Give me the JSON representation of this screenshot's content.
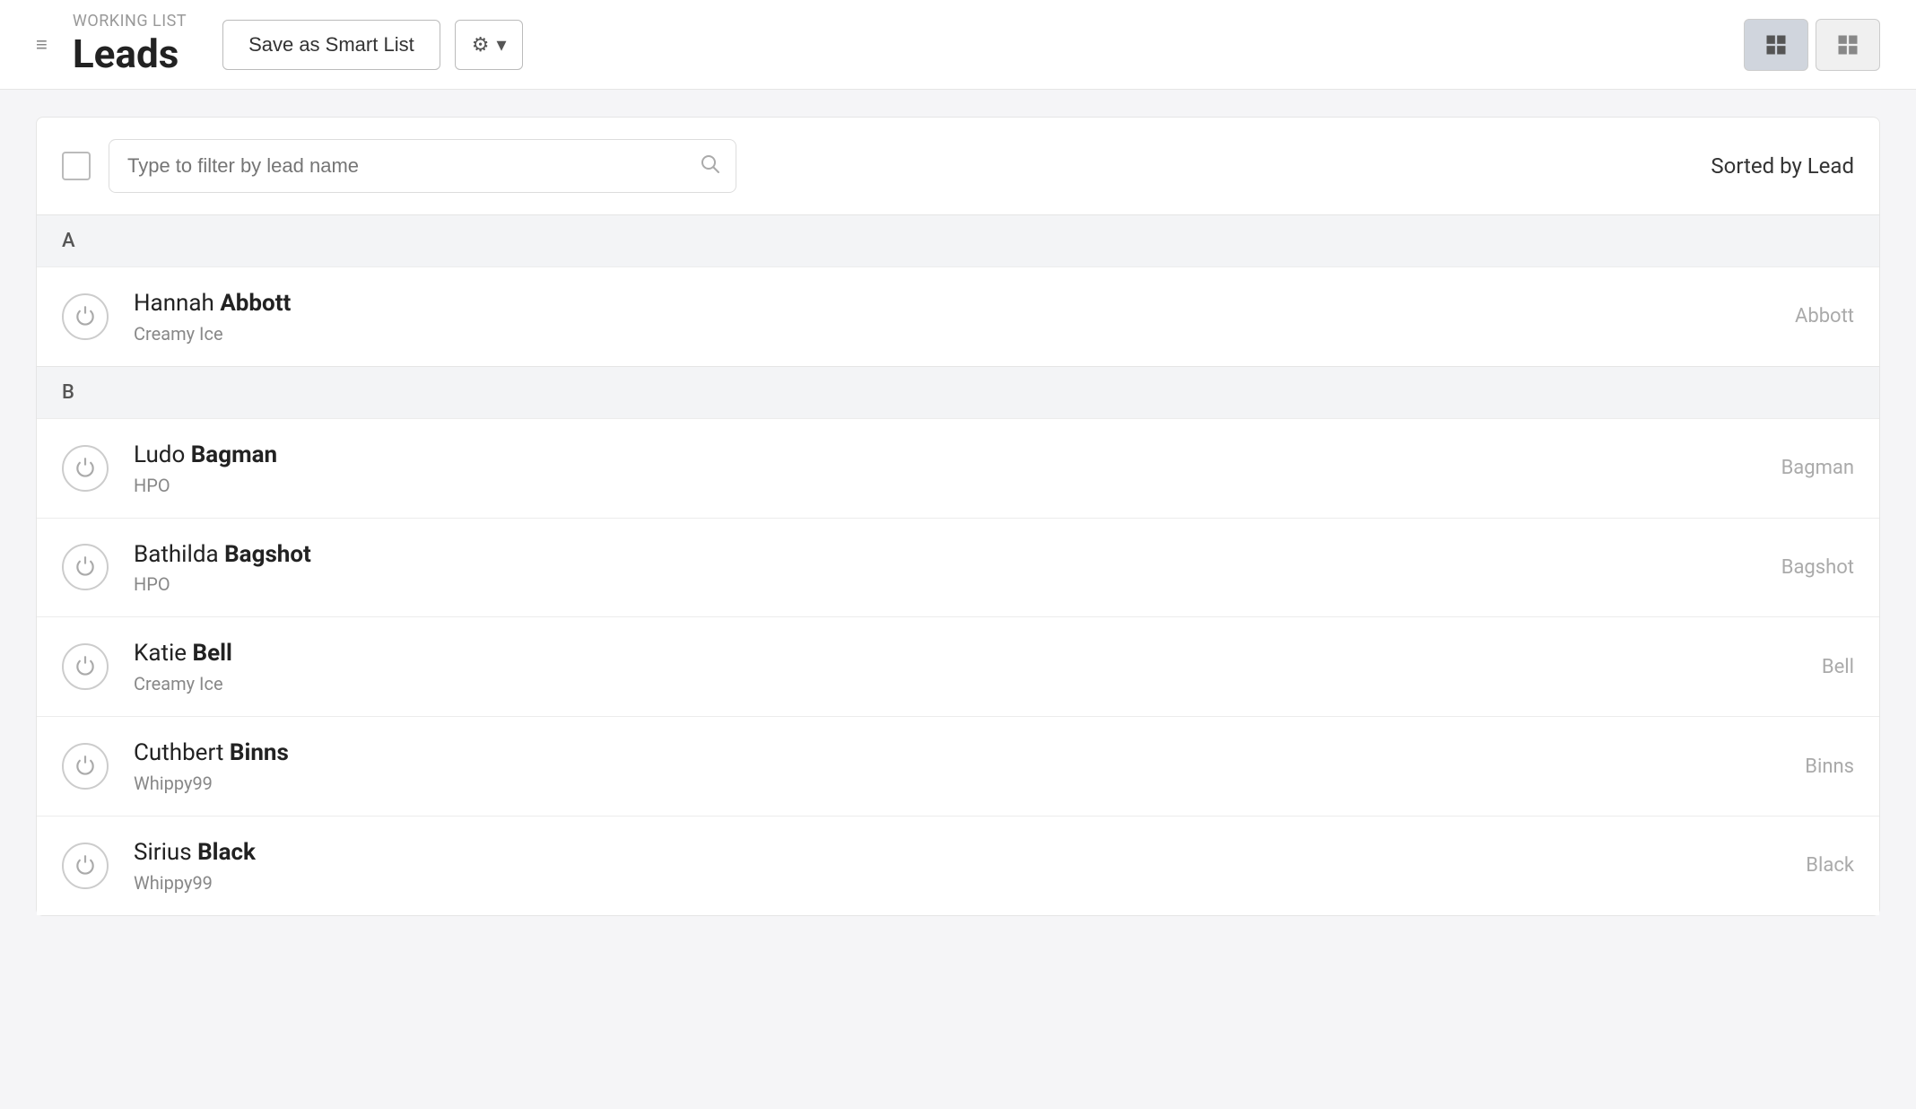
{
  "header": {
    "hamburger": "≡",
    "working_list_label": "WORKING LIST",
    "page_title": "Leads",
    "save_smart_list_label": "Save as Smart List",
    "gear_label": "⚙",
    "chevron_label": "▾",
    "view_list_icon": "▦",
    "view_grid_icon": "⊞"
  },
  "filter_bar": {
    "search_placeholder": "Type to filter by lead name",
    "search_icon": "🔍",
    "sorted_by_label": "Sorted by Lead"
  },
  "groups": [
    {
      "letter": "A",
      "items": [
        {
          "first_name": "Hannah",
          "last_name": "Abbott",
          "company": "Creamy Ice",
          "sort_label": "Abbott"
        }
      ]
    },
    {
      "letter": "B",
      "items": [
        {
          "first_name": "Ludo",
          "last_name": "Bagman",
          "company": "HPO",
          "sort_label": "Bagman"
        },
        {
          "first_name": "Bathilda",
          "last_name": "Bagshot",
          "company": "HPO",
          "sort_label": "Bagshot"
        },
        {
          "first_name": "Katie",
          "last_name": "Bell",
          "company": "Creamy Ice",
          "sort_label": "Bell"
        },
        {
          "first_name": "Cuthbert",
          "last_name": "Binns",
          "company": "Whippy99",
          "sort_label": "Binns"
        },
        {
          "first_name": "Sirius",
          "last_name": "Black",
          "company": "Whippy99",
          "sort_label": "Black"
        }
      ]
    }
  ]
}
